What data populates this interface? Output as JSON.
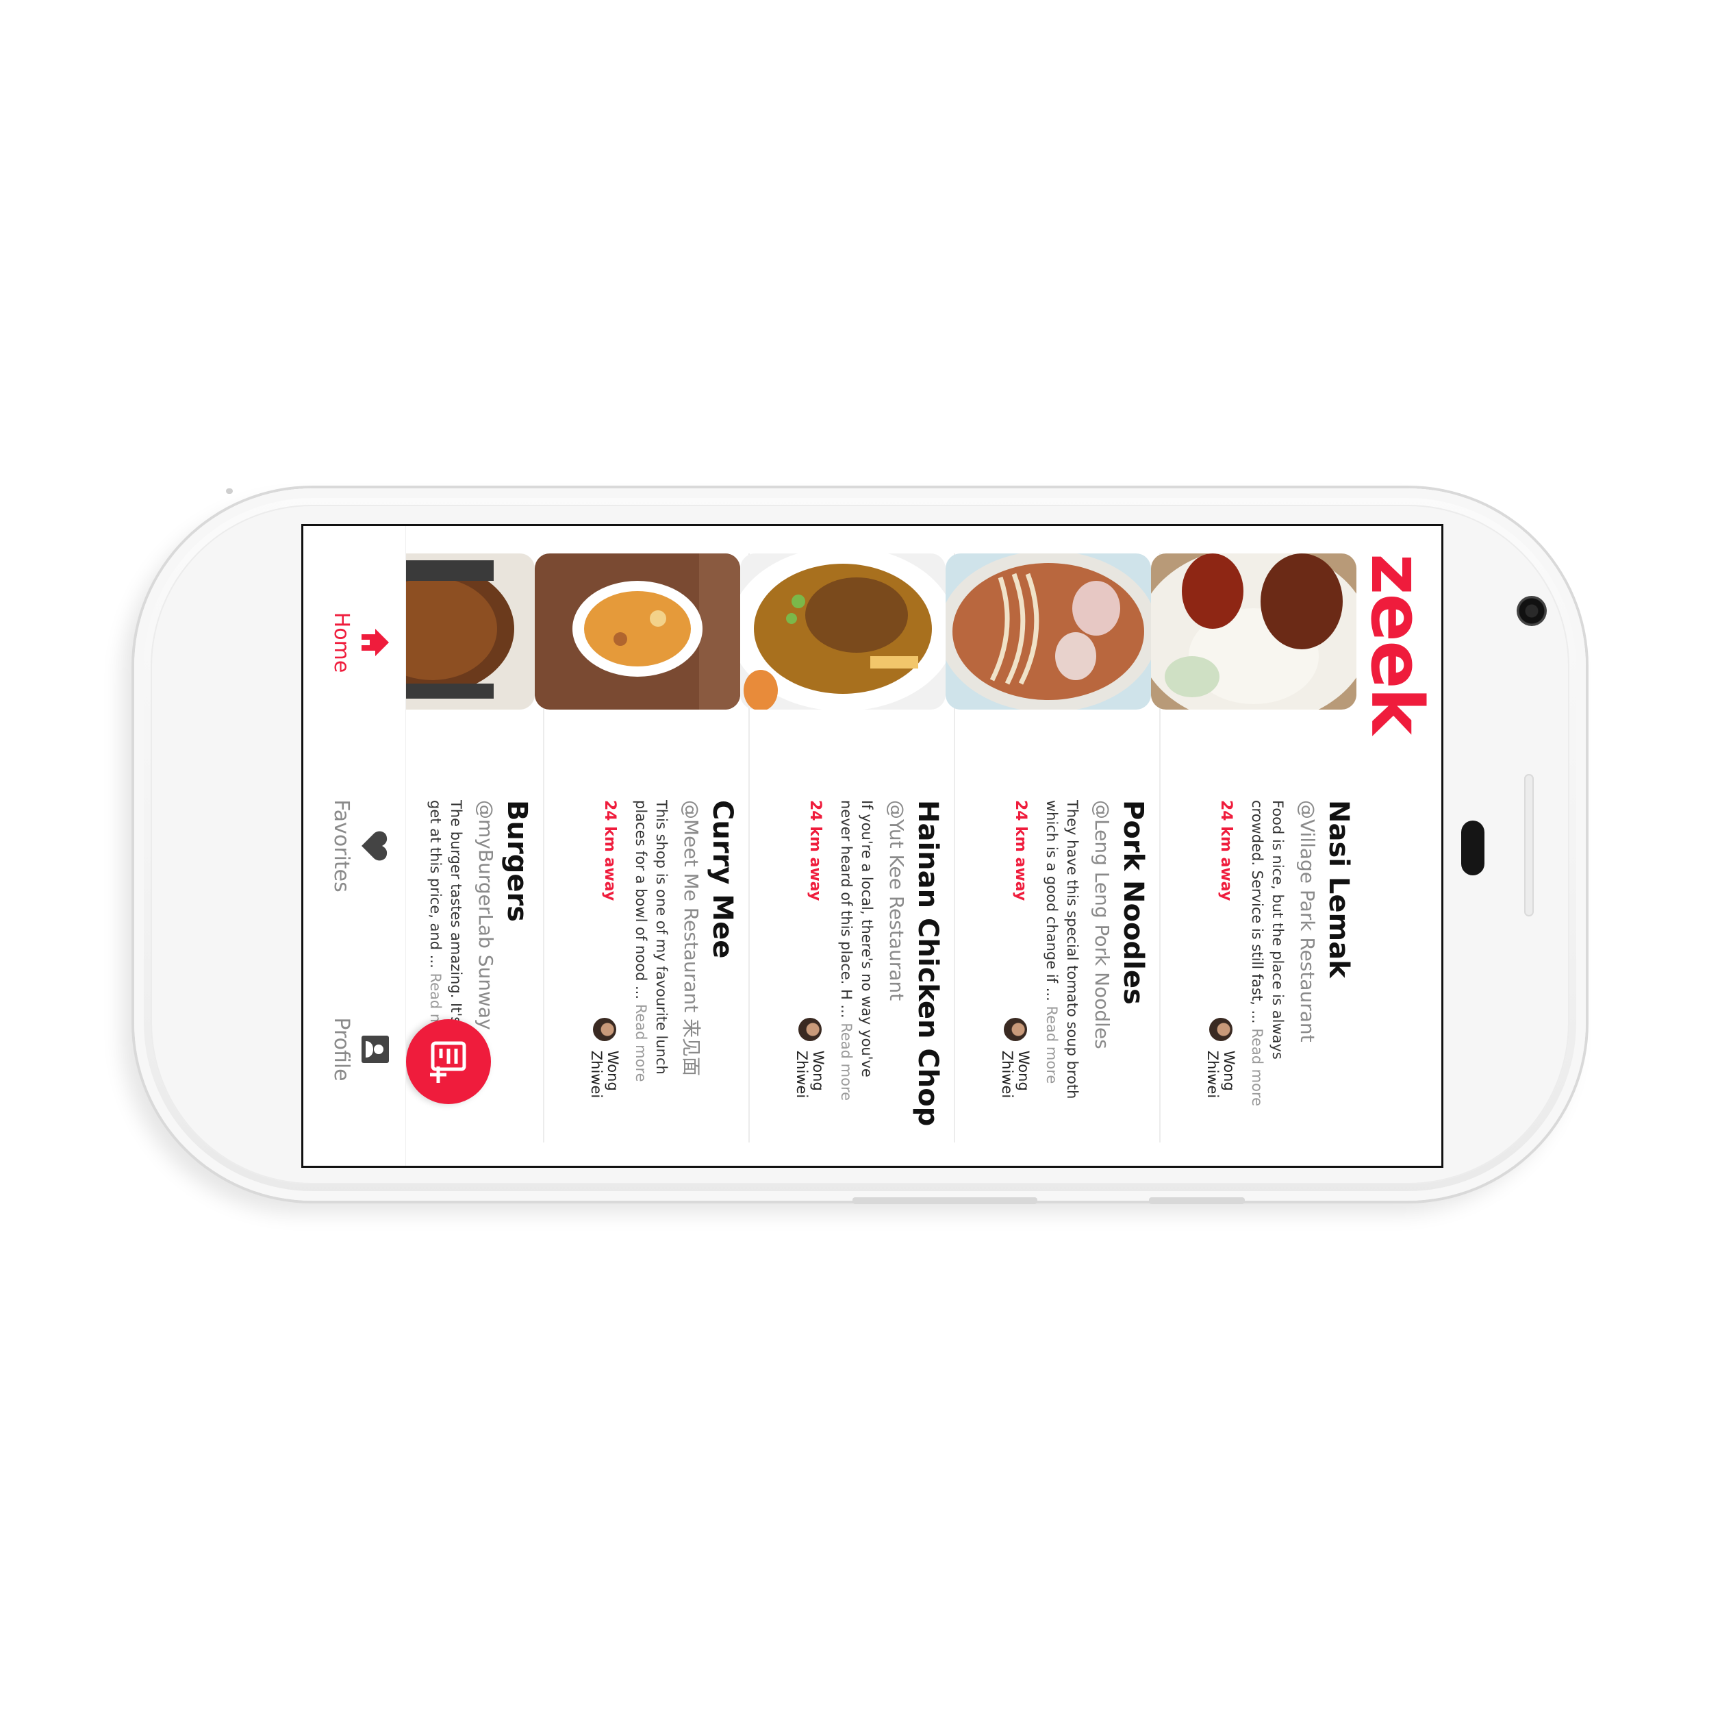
{
  "app": {
    "logo": "zeek",
    "accent_color": "#ef1c3c"
  },
  "feed": {
    "items": [
      {
        "title": "Nasi Lemak",
        "place": "@Village Park Restaurant",
        "description": "Food is nice, but the place is always crowded. Service is still fast, ...",
        "read_more": "Read more",
        "distance": "24 km away",
        "author": "Wong Zhiwei",
        "image_icon": "nasi-lemak-photo"
      },
      {
        "title": "Pork Noodles",
        "place": "@Leng Leng Pork Noodles",
        "description": "They have this special tomato soup broth which is a good change if ...",
        "read_more": "Read more",
        "distance": "24 km away",
        "author": "Wong Zhiwei",
        "image_icon": "pork-noodles-photo"
      },
      {
        "title": "Hainan Chicken Chop",
        "place": "@Yut Kee Restaurant",
        "description": "If you're a local, there's no way you've never heard of this place. H ...",
        "read_more": "Read more",
        "distance": "24 km away",
        "author": "Wong Zhiwei",
        "image_icon": "chicken-chop-photo"
      },
      {
        "title": "Curry Mee",
        "place": "@Meet Me Restaurant 来见面",
        "description": "This shop is one of my favourite lunch places for a bowl of nood ...",
        "read_more": "Read more",
        "distance": "24 km away",
        "author": "Wong Zhiwei",
        "image_icon": "curry-mee-photo"
      },
      {
        "title": "Burgers",
        "place": "@myBurgerLab Sunway",
        "description": "The burger tastes amazing. It's the b can get at this price, and ...",
        "read_more": "Read more",
        "distance": "",
        "author": "",
        "image_icon": "burger-photo"
      }
    ]
  },
  "fab": {
    "icon": "add-post-icon"
  },
  "nav": {
    "items": [
      {
        "label": "Home",
        "icon": "home-icon",
        "active": true
      },
      {
        "label": "Favorites",
        "icon": "heart-icon",
        "active": false
      },
      {
        "label": "Profile",
        "icon": "profile-icon",
        "active": false
      }
    ]
  }
}
